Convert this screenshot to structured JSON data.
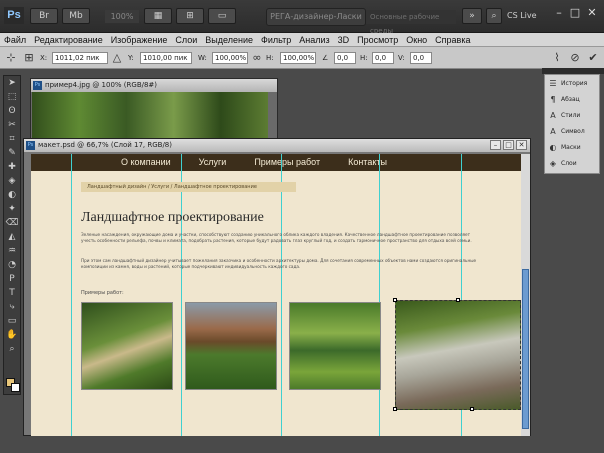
{
  "app": {
    "logo": "Ps",
    "mode_icon": "Br",
    "mini_icon": "Mb",
    "zoom": "100%",
    "active_title": "РЕГА-дизайнер-Ласки",
    "search_placeholder": "Основные рабочие среды",
    "cslive": "CS Live",
    "win_min": "–",
    "win_max": "□",
    "win_close": "✕"
  },
  "menubar": [
    "Файл",
    "Редактирование",
    "Изображение",
    "Слои",
    "Выделение",
    "Фильтр",
    "Анализ",
    "3D",
    "Просмотр",
    "Окно",
    "Справка"
  ],
  "options": {
    "x_label": "X:",
    "x_value": "1011,02 пик",
    "y_label": "Y:",
    "y_value": "1010,00 пик",
    "w_label": "W:",
    "w_value": "100,00%",
    "h_label": "H:",
    "h_value": "100,00%",
    "angle_label": "∠",
    "angle_value": "0,0",
    "hskew_label": "H:",
    "hskew_value": "0,0",
    "vskew_label": "V:",
    "vskew_value": "0,0",
    "cancel_icon": "⊘",
    "commit_icon": "✔"
  },
  "tools": [
    "➤",
    "⬚",
    "ʘ",
    "✂",
    "⌗",
    "✎",
    "✚",
    "◈",
    "◐",
    "✦",
    "⌫",
    "◭",
    "♒",
    "◔",
    "P",
    "T",
    "⤷",
    "▭",
    "✋",
    "⌕"
  ],
  "right_panel": [
    {
      "icon": "☰",
      "label": "История"
    },
    {
      "icon": "¶",
      "label": "Абзац"
    },
    {
      "icon": "A",
      "label": "Стили"
    },
    {
      "icon": "A",
      "label": "Символ"
    },
    {
      "icon": "◐",
      "label": "Маски"
    },
    {
      "icon": "◈",
      "label": "Слои"
    }
  ],
  "doc2": {
    "icon": "Ps",
    "title": "пример4.jpg @ 100% (RGB/8#)"
  },
  "doc": {
    "icon": "Ps",
    "title": "макет.psd @ 66,7% (Слой 17, RGB/8)",
    "min": "–",
    "max": "□",
    "close": "✕"
  },
  "site": {
    "nav": [
      "О компании",
      "Услуги",
      "Примеры работ",
      "Контакты"
    ],
    "breadcrumb": "Ландшафтный дизайн  /  Услуги  /  Ландшафтное проектирование",
    "heading": "Ландшафтное проектирование",
    "para1": "Зеленые насаждения, окружающие дома и участки, способствуют созданию уникального облика каждого владения. Качественное ландшафтное проектирование позволяет учесть особенности рельефа, почвы и климата, подобрать растения, которые будут радовать глаз круглый год, и создать гармоничное пространство для отдыха всей семьи.",
    "para2": "При этом сам ландшафтный дизайнер учитывает пожелания заказчика и особенности архитектуры дома. Для сочетания современных объектов нами создаются оригинальные композиции из камня, воды и растений, которые подчеркивают индивидуальность каждого сада.",
    "examples_label": "Примеры работ:"
  }
}
